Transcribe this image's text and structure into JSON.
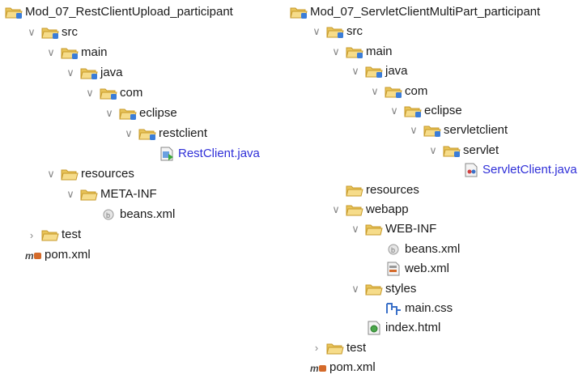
{
  "left_tree": [
    {
      "label": "Mod_07_RestClientUpload_participant",
      "icon": "project-folder-icon",
      "toggle": "none",
      "depth": 0
    },
    {
      "label": "src",
      "icon": "source-folder-icon",
      "toggle": "expanded",
      "depth": 1
    },
    {
      "label": "main",
      "icon": "source-folder-icon",
      "toggle": "expanded",
      "depth": 2
    },
    {
      "label": "java",
      "icon": "source-folder-icon",
      "toggle": "expanded",
      "depth": 3
    },
    {
      "label": "com",
      "icon": "source-folder-icon",
      "toggle": "expanded",
      "depth": 4
    },
    {
      "label": "eclipse",
      "icon": "source-folder-icon",
      "toggle": "expanded",
      "depth": 5
    },
    {
      "label": "restclient",
      "icon": "source-folder-icon",
      "toggle": "expanded",
      "depth": 6
    },
    {
      "label": "RestClient.java",
      "icon": "java-file-icon",
      "toggle": "none",
      "depth": 7,
      "link": true
    },
    {
      "label": "resources",
      "icon": "folder-icon",
      "toggle": "expanded",
      "depth": 2
    },
    {
      "label": "META-INF",
      "icon": "folder-icon",
      "toggle": "expanded",
      "depth": 3
    },
    {
      "label": "beans.xml",
      "icon": "xml-file-icon",
      "toggle": "none",
      "depth": 4
    },
    {
      "label": "test",
      "icon": "folder-icon",
      "toggle": "collapsed",
      "depth": 1
    },
    {
      "label": "pom.xml",
      "icon": "maven-pom-icon",
      "toggle": "none",
      "depth": 1,
      "notoggle": true
    }
  ],
  "right_tree": [
    {
      "label": "Mod_07_ServletClientMultiPart_participant",
      "icon": "project-folder-icon",
      "toggle": "none",
      "depth": 0
    },
    {
      "label": "src",
      "icon": "source-folder-icon",
      "toggle": "expanded",
      "depth": 1
    },
    {
      "label": "main",
      "icon": "source-folder-icon",
      "toggle": "expanded",
      "depth": 2
    },
    {
      "label": "java",
      "icon": "source-folder-icon",
      "toggle": "expanded",
      "depth": 3
    },
    {
      "label": "com",
      "icon": "source-folder-icon",
      "toggle": "expanded",
      "depth": 4
    },
    {
      "label": "eclipse",
      "icon": "source-folder-icon",
      "toggle": "expanded",
      "depth": 5
    },
    {
      "label": "servletclient",
      "icon": "source-folder-icon",
      "toggle": "expanded",
      "depth": 6
    },
    {
      "label": "servlet",
      "icon": "source-folder-icon",
      "toggle": "expanded",
      "depth": 7
    },
    {
      "label": "ServletClient.java",
      "icon": "servlet-file-icon",
      "toggle": "none",
      "depth": 8,
      "link": true
    },
    {
      "label": "resources",
      "icon": "folder-icon",
      "toggle": "none",
      "depth": 2
    },
    {
      "label": "webapp",
      "icon": "folder-icon",
      "toggle": "expanded",
      "depth": 2
    },
    {
      "label": "WEB-INF",
      "icon": "folder-icon",
      "toggle": "expanded",
      "depth": 3
    },
    {
      "label": "beans.xml",
      "icon": "xml-file-icon",
      "toggle": "none",
      "depth": 4
    },
    {
      "label": "web.xml",
      "icon": "webxml-file-icon",
      "toggle": "none",
      "depth": 4
    },
    {
      "label": "styles",
      "icon": "folder-icon",
      "toggle": "expanded",
      "depth": 3
    },
    {
      "label": "main.css",
      "icon": "css-file-icon",
      "toggle": "none",
      "depth": 4
    },
    {
      "label": "index.html",
      "icon": "html-file-icon",
      "toggle": "none",
      "depth": 3
    },
    {
      "label": "test",
      "icon": "folder-icon",
      "toggle": "collapsed",
      "depth": 1
    },
    {
      "label": "pom.xml",
      "icon": "maven-pom-icon",
      "toggle": "none",
      "depth": 1,
      "notoggle": true
    }
  ],
  "colors": {
    "folder": "#e8c45a",
    "folder_dark": "#c79a2a",
    "source_badge": "#3b7dd8",
    "link": "#2f2fd8"
  }
}
